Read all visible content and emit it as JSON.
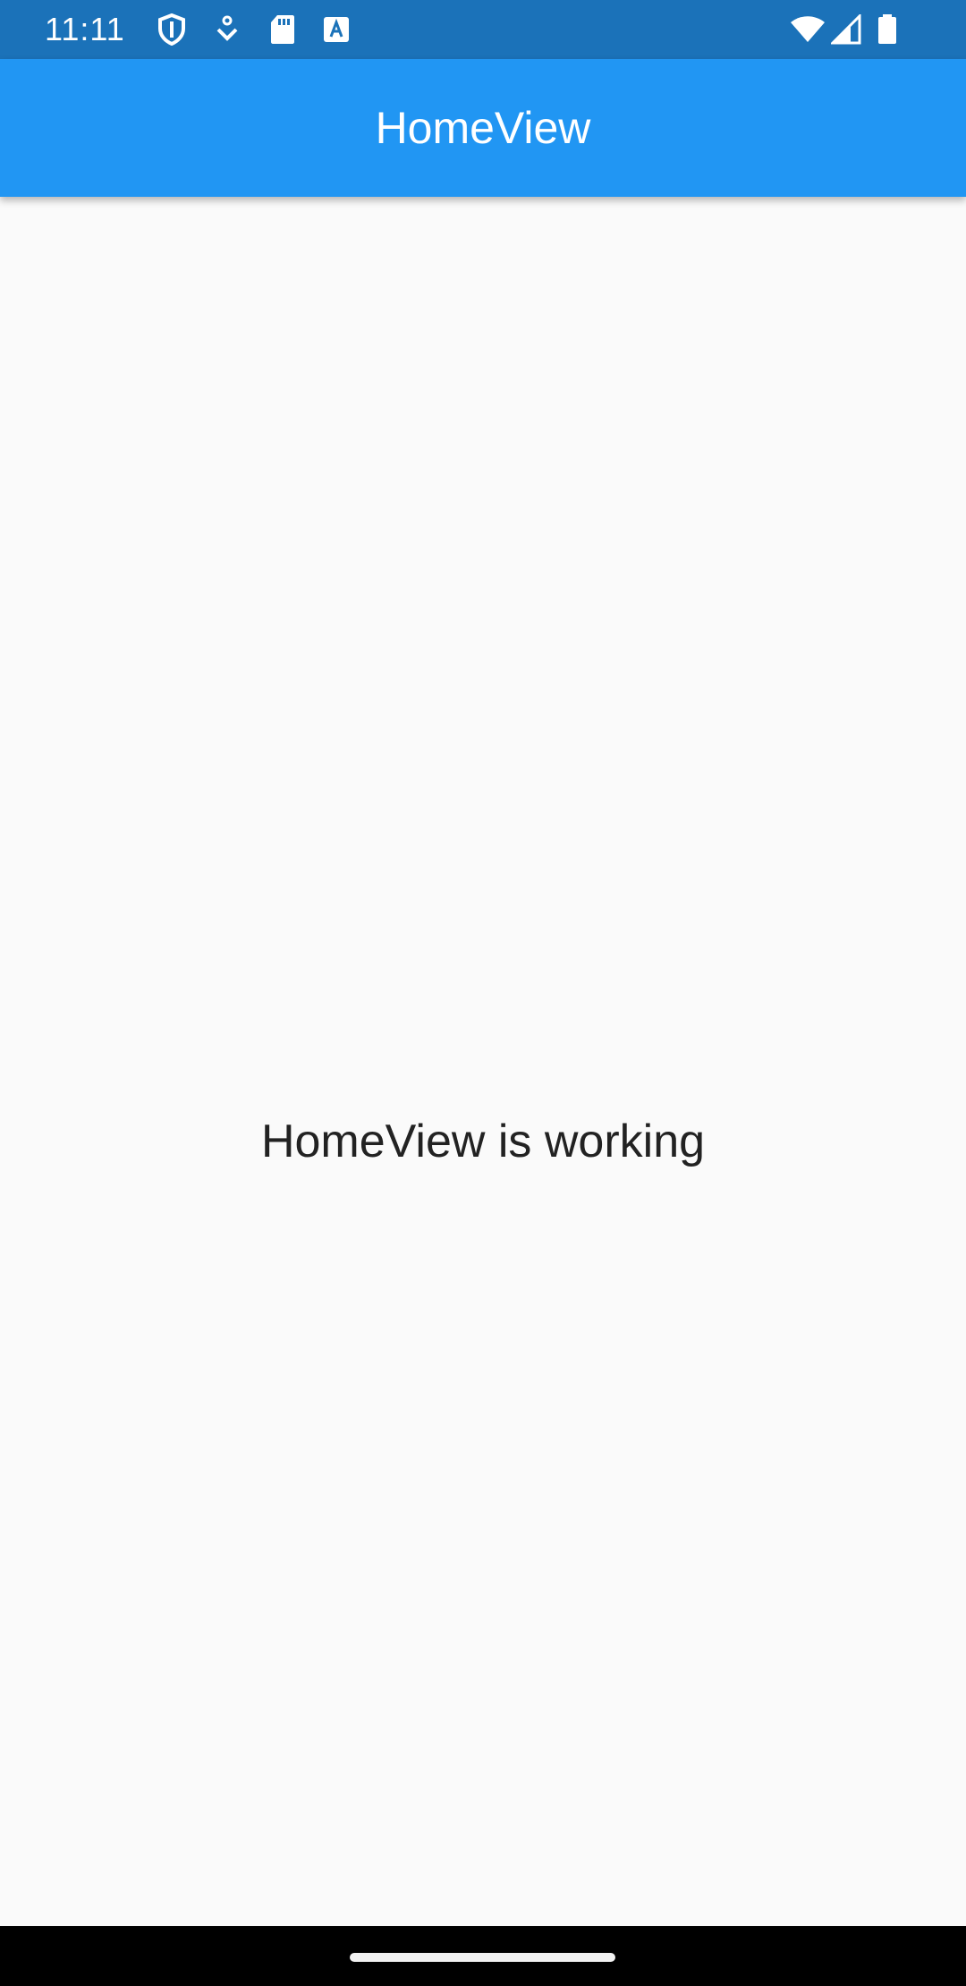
{
  "status_bar": {
    "time": "11:11",
    "left_icons": [
      "shield-icon",
      "download-icon",
      "sd-card-icon",
      "text-a-icon"
    ],
    "right_icons": [
      "wifi-icon",
      "signal-icon",
      "battery-icon"
    ],
    "background_color": "#1b72b9"
  },
  "app_bar": {
    "title": "HomeView",
    "background_color": "#2196f3"
  },
  "body": {
    "message": "HomeView is working",
    "background_color": "#fafafa"
  },
  "navigation_bar": {
    "background_color": "#000000",
    "home_indicator": "home-gesture-pill"
  }
}
